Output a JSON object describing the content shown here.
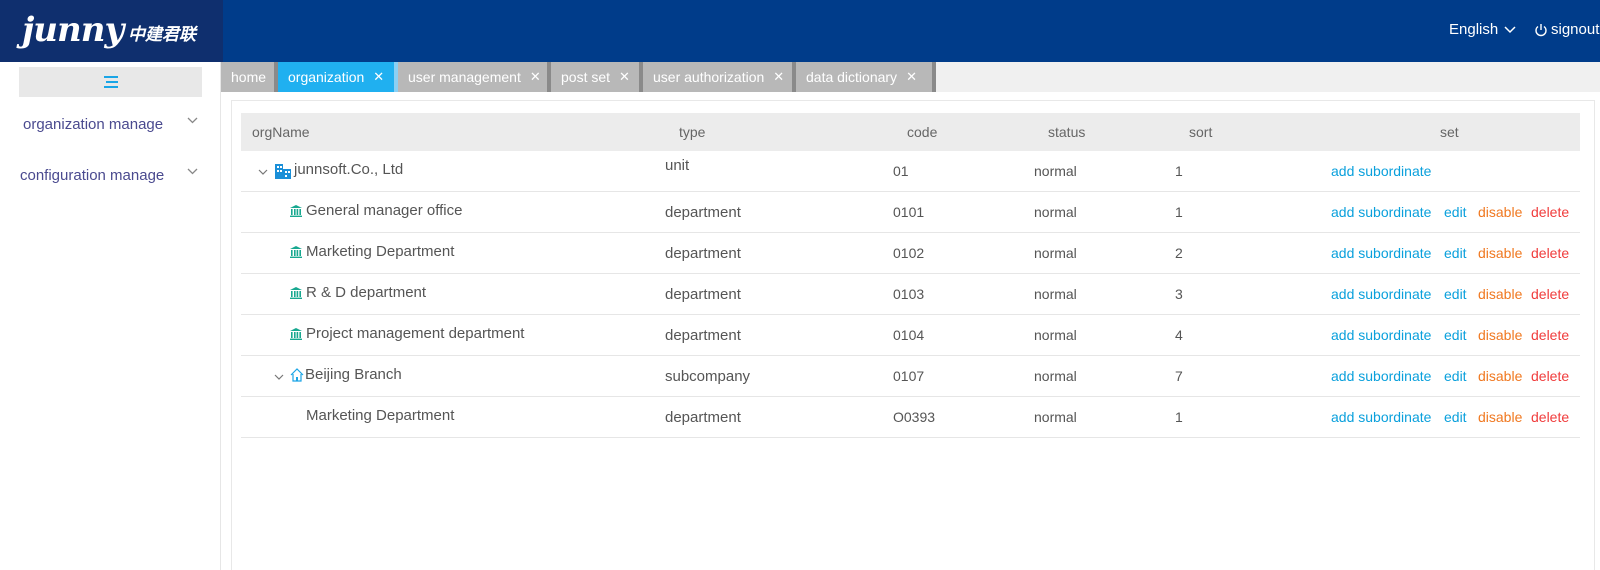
{
  "header": {
    "logo_text": "junny",
    "logo_cn": "中建君联",
    "language": "English",
    "signout": "signout"
  },
  "sidebar": {
    "items": [
      {
        "label": "organization manage"
      },
      {
        "label": "configuration manage"
      }
    ]
  },
  "tabs": [
    {
      "label": "home"
    },
    {
      "label": "organization"
    },
    {
      "label": "user management"
    },
    {
      "label": "post set"
    },
    {
      "label": "user authorization"
    },
    {
      "label": "data dictionary"
    }
  ],
  "table": {
    "columns": [
      "orgName",
      "type",
      "code",
      "status",
      "sort",
      "set"
    ],
    "actions": {
      "add": "add subordinate",
      "edit": "edit",
      "disable": "disable",
      "delete": "delete"
    },
    "rows": [
      {
        "name": "junnsoft.Co., Ltd",
        "type": "unit",
        "code": "01",
        "status": "normal",
        "sort": "1",
        "icon": "building-icon"
      },
      {
        "name": "General manager office",
        "type": "department",
        "code": "0101",
        "status": "normal",
        "sort": "1",
        "icon": "bank-icon"
      },
      {
        "name": "Marketing Department",
        "type": "department",
        "code": "0102",
        "status": "normal",
        "sort": "2",
        "icon": "bank-icon"
      },
      {
        "name": "R & D department",
        "type": "department",
        "code": "0103",
        "status": "normal",
        "sort": "3",
        "icon": "bank-icon"
      },
      {
        "name": "Project management department",
        "type": "department",
        "code": "0104",
        "status": "normal",
        "sort": "4",
        "icon": "bank-icon"
      },
      {
        "name": "Beijing Branch",
        "type": "subcompany",
        "code": "0107",
        "status": "normal",
        "sort": "7",
        "icon": "home-icon"
      },
      {
        "name": "Marketing Department",
        "type": "department",
        "code": "O0393",
        "status": "normal",
        "sort": "1",
        "icon": "none"
      }
    ]
  },
  "colors": {
    "header": "#003c8a",
    "tab_active": "#20b0f0",
    "link": "#0aa0dc",
    "disable": "#f07820",
    "delete": "#f03c3c"
  }
}
